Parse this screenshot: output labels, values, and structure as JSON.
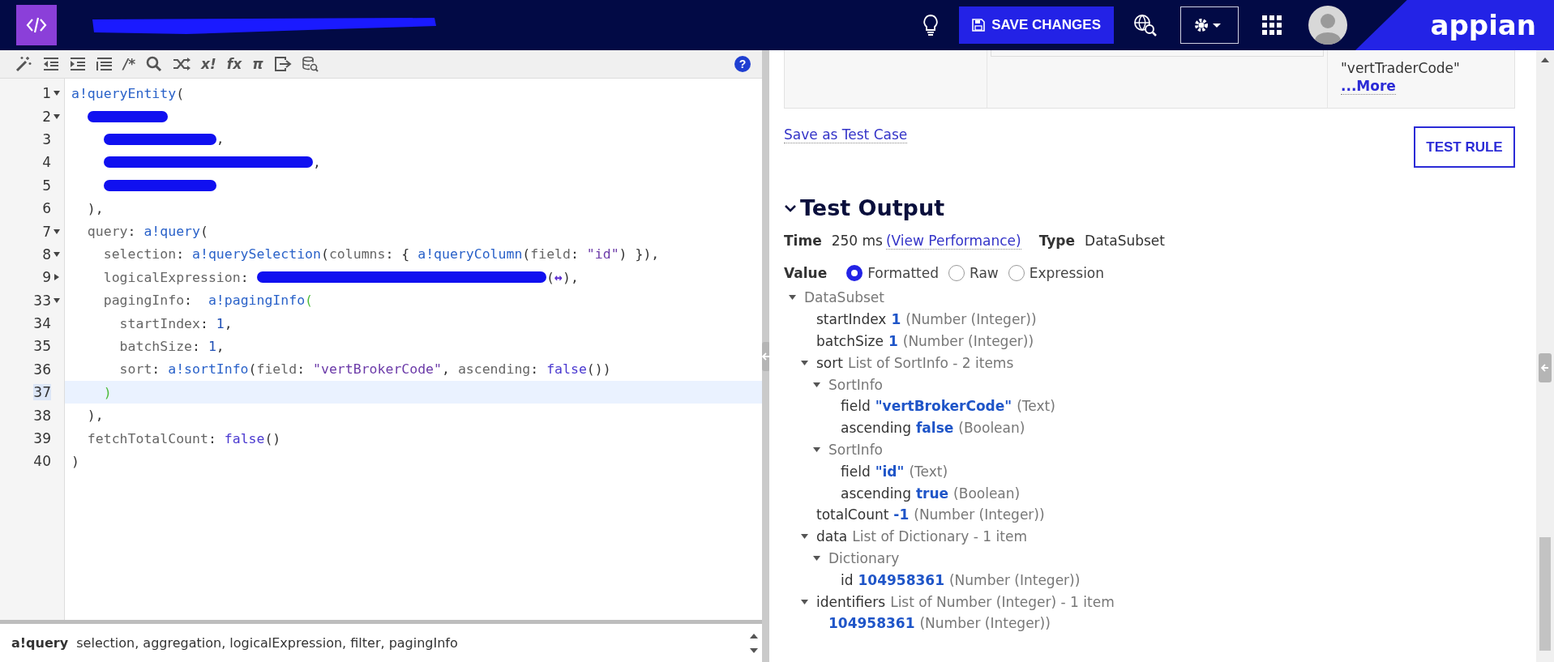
{
  "header": {
    "save_button": "SAVE CHANGES",
    "logo": "appian"
  },
  "toolbar": [
    {
      "kind": "icon"
    },
    {
      "kind": "icon"
    },
    {
      "kind": "icon"
    },
    {
      "kind": "icon"
    },
    {
      "kind": "glyph",
      "text": "/*"
    },
    {
      "kind": "icon"
    },
    {
      "kind": "icon"
    },
    {
      "kind": "glyph",
      "text": "x!"
    },
    {
      "kind": "glyph",
      "text": "fx"
    },
    {
      "kind": "glyph",
      "text": "π"
    },
    {
      "kind": "icon"
    },
    {
      "kind": "icon"
    }
  ],
  "help": "?",
  "code_lines": [
    {
      "number": "1",
      "expanded": true,
      "current": false,
      "tokens": [
        {
          "kind": "func",
          "text": "a!queryEntity"
        },
        {
          "kind": "plain",
          "text": "("
        }
      ]
    },
    {
      "number": "2",
      "expanded": true,
      "current": false,
      "tokens": [
        {
          "kind": "redacted-short"
        }
      ]
    },
    {
      "number": "3",
      "current": false,
      "tokens": [
        {
          "kind": "redacted-mid"
        },
        {
          "kind": "plain",
          "text": ","
        }
      ]
    },
    {
      "number": "4",
      "current": false,
      "tokens": [
        {
          "kind": "redacted-long"
        },
        {
          "kind": "plain",
          "text": ","
        }
      ]
    },
    {
      "number": "5",
      "current": false,
      "tokens": [
        {
          "kind": "redacted-mid"
        }
      ]
    },
    {
      "number": "6",
      "current": false,
      "tokens": [
        {
          "kind": "plain",
          "text": "  ),"
        }
      ]
    },
    {
      "number": "7",
      "expanded": true,
      "current": false,
      "tokens": [
        {
          "kind": "param",
          "text": "  query"
        },
        {
          "kind": "plain",
          "text": ": "
        },
        {
          "kind": "func",
          "text": "a!query"
        },
        {
          "kind": "plain",
          "text": "("
        }
      ]
    },
    {
      "number": "8",
      "expanded": true,
      "current": false,
      "tokens": [
        {
          "kind": "param",
          "text": "    selection"
        },
        {
          "kind": "plain",
          "text": ": "
        },
        {
          "kind": "func",
          "text": "a!querySelection"
        },
        {
          "kind": "plain",
          "text": "("
        },
        {
          "kind": "param",
          "text": "columns"
        },
        {
          "kind": "plain",
          "text": ": { "
        },
        {
          "kind": "func",
          "text": "a!queryColumn"
        },
        {
          "kind": "plain",
          "text": "("
        },
        {
          "kind": "param",
          "text": "field"
        },
        {
          "kind": "plain",
          "text": ": "
        },
        {
          "kind": "string",
          "text": "\"id\""
        },
        {
          "kind": "plain",
          "text": ") }),"
        }
      ]
    },
    {
      "number": "9",
      "expanded": false,
      "current": false,
      "tokens": [
        {
          "kind": "param",
          "text": "    logicalExpression"
        },
        {
          "kind": "plain",
          "text": ": "
        },
        {
          "kind": "redacted-inline"
        },
        {
          "kind": "plain",
          "text": "("
        },
        {
          "kind": "widget",
          "text": "↔"
        },
        {
          "kind": "plain",
          "text": "),"
        }
      ]
    },
    {
      "number": "33",
      "expanded": true,
      "current": false,
      "tokens": [
        {
          "kind": "param",
          "text": "    pagingInfo"
        },
        {
          "kind": "plain",
          "text": ":  "
        },
        {
          "kind": "func",
          "text": "a!pagingInfo"
        },
        {
          "kind": "match",
          "text": "("
        }
      ]
    },
    {
      "number": "34",
      "current": false,
      "tokens": [
        {
          "kind": "param",
          "text": "      startIndex"
        },
        {
          "kind": "plain",
          "text": ": "
        },
        {
          "kind": "number",
          "text": "1"
        },
        {
          "kind": "plain",
          "text": ","
        }
      ]
    },
    {
      "number": "35",
      "current": false,
      "tokens": [
        {
          "kind": "param",
          "text": "      batchSize"
        },
        {
          "kind": "plain",
          "text": ": "
        },
        {
          "kind": "number",
          "text": "1"
        },
        {
          "kind": "plain",
          "text": ","
        }
      ]
    },
    {
      "number": "36",
      "current": false,
      "tokens": [
        {
          "kind": "param",
          "text": "      sort"
        },
        {
          "kind": "plain",
          "text": ": "
        },
        {
          "kind": "func",
          "text": "a!sortInfo"
        },
        {
          "kind": "plain",
          "text": "("
        },
        {
          "kind": "param",
          "text": "field"
        },
        {
          "kind": "plain",
          "text": ": "
        },
        {
          "kind": "string",
          "text": "\"vertBrokerCode\""
        },
        {
          "kind": "plain",
          "text": ", "
        },
        {
          "kind": "param",
          "text": "ascending"
        },
        {
          "kind": "plain",
          "text": ": "
        },
        {
          "kind": "keyword",
          "text": "false"
        },
        {
          "kind": "plain",
          "text": "())"
        }
      ]
    },
    {
      "number": "37",
      "current": true,
      "tokens": [
        {
          "kind": "match",
          "text": "    )"
        }
      ]
    },
    {
      "number": "38",
      "current": false,
      "tokens": [
        {
          "kind": "plain",
          "text": "  ),"
        }
      ]
    },
    {
      "number": "39",
      "current": false,
      "tokens": [
        {
          "kind": "param",
          "text": "  fetchTotalCount"
        },
        {
          "kind": "plain",
          "text": ": "
        },
        {
          "kind": "keyword",
          "text": "false"
        },
        {
          "kind": "plain",
          "text": "()"
        }
      ]
    },
    {
      "number": "40",
      "current": false,
      "tokens": [
        {
          "kind": "plain",
          "text": ")"
        }
      ]
    }
  ],
  "hint": {
    "function": "a!query",
    "params": "selection, aggregation, logicalExpression, filter, pagingInfo"
  },
  "previous_result": {
    "value_lines": [
      "\"vertTraderCode\""
    ],
    "more_link": "...More"
  },
  "save_test_case": "Save as Test Case",
  "test_rule_button": "TEST RULE",
  "test_output": {
    "title": "Test Output",
    "expanded": true,
    "time_label": "Time",
    "time": "250 ms",
    "performance_link": "(View Performance)",
    "type_label": "Type",
    "type": "DataSubset",
    "value_label": "Value",
    "formats": [
      {
        "label": "Formatted",
        "selected": true
      },
      {
        "label": "Raw",
        "selected": false
      },
      {
        "label": "Expression",
        "selected": false
      }
    ],
    "tree": [
      {
        "type": "DataSubset",
        "expanded": true,
        "children": [
          {
            "name": "startIndex",
            "value": "1",
            "type": "(Number (Integer))"
          },
          {
            "name": "batchSize",
            "value": "1",
            "type": "(Number (Integer))"
          },
          {
            "name": "sort",
            "type": "List of SortInfo - 2 items",
            "expanded": true,
            "children": [
              {
                "type": "SortInfo",
                "expanded": true,
                "children": [
                  {
                    "name": "field",
                    "value": "\"vertBrokerCode\"",
                    "type": "(Text)"
                  },
                  {
                    "name": "ascending",
                    "value": "false",
                    "type": "(Boolean)"
                  }
                ]
              },
              {
                "type": "SortInfo",
                "expanded": true,
                "children": [
                  {
                    "name": "field",
                    "value": "\"id\"",
                    "type": "(Text)"
                  },
                  {
                    "name": "ascending",
                    "value": "true",
                    "type": "(Boolean)"
                  }
                ]
              }
            ]
          },
          {
            "name": "totalCount",
            "value": "-1",
            "type": "(Number (Integer))"
          },
          {
            "name": "data",
            "type": "List of Dictionary - 1 item",
            "expanded": true,
            "children": [
              {
                "type": "Dictionary",
                "expanded": true,
                "children": [
                  {
                    "name": "id",
                    "value": "104958361",
                    "type": "(Number (Integer))"
                  }
                ]
              }
            ]
          },
          {
            "name": "identifiers",
            "type": "List of Number (Integer) - 1 item",
            "expanded": true,
            "children": [
              {
                "value": "104958361",
                "type": "(Number (Integer))"
              }
            ]
          }
        ]
      }
    ]
  }
}
